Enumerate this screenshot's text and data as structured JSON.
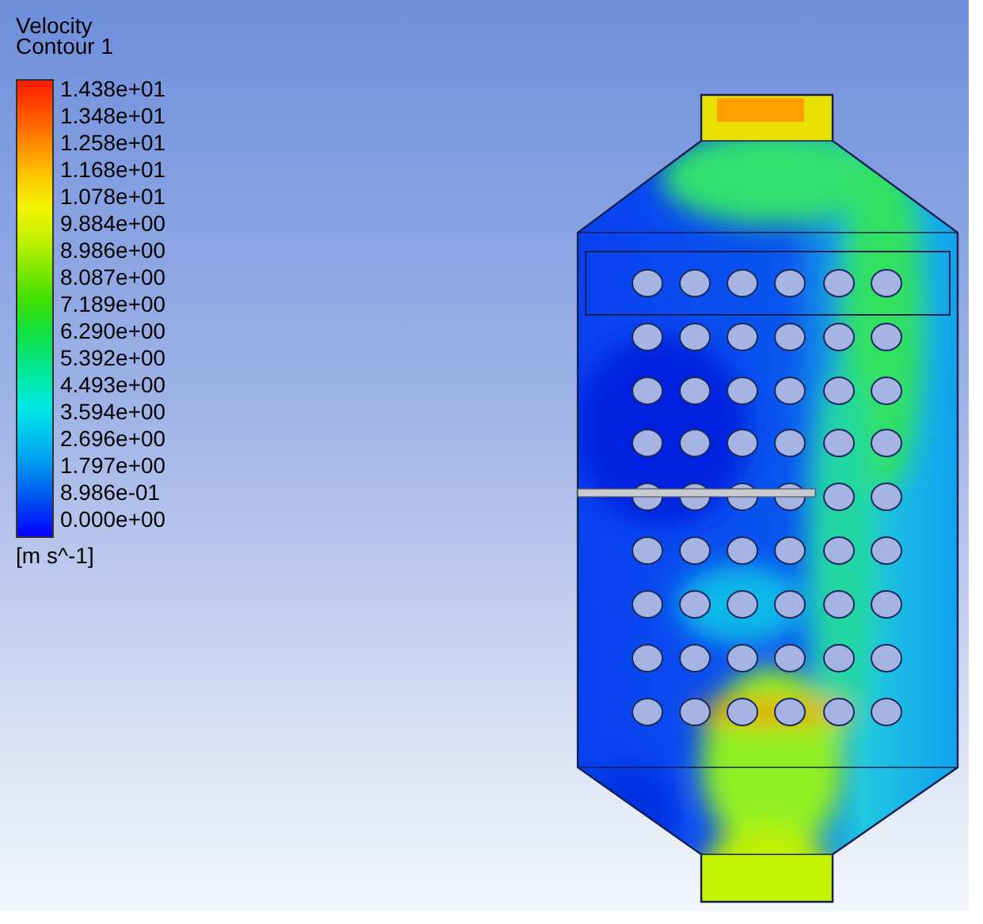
{
  "title": "Velocity",
  "subtitle": "Contour 1",
  "legend": {
    "labels": [
      "1.438e+01",
      "1.348e+01",
      "1.258e+01",
      "1.168e+01",
      "1.078e+01",
      "9.884e+00",
      "8.986e+00",
      "8.087e+00",
      "7.189e+00",
      "6.290e+00",
      "5.392e+00",
      "4.493e+00",
      "3.594e+00",
      "2.696e+00",
      "1.797e+00",
      "8.986e-01",
      "0.000e+00"
    ],
    "unit": "[m s^-1]"
  }
}
